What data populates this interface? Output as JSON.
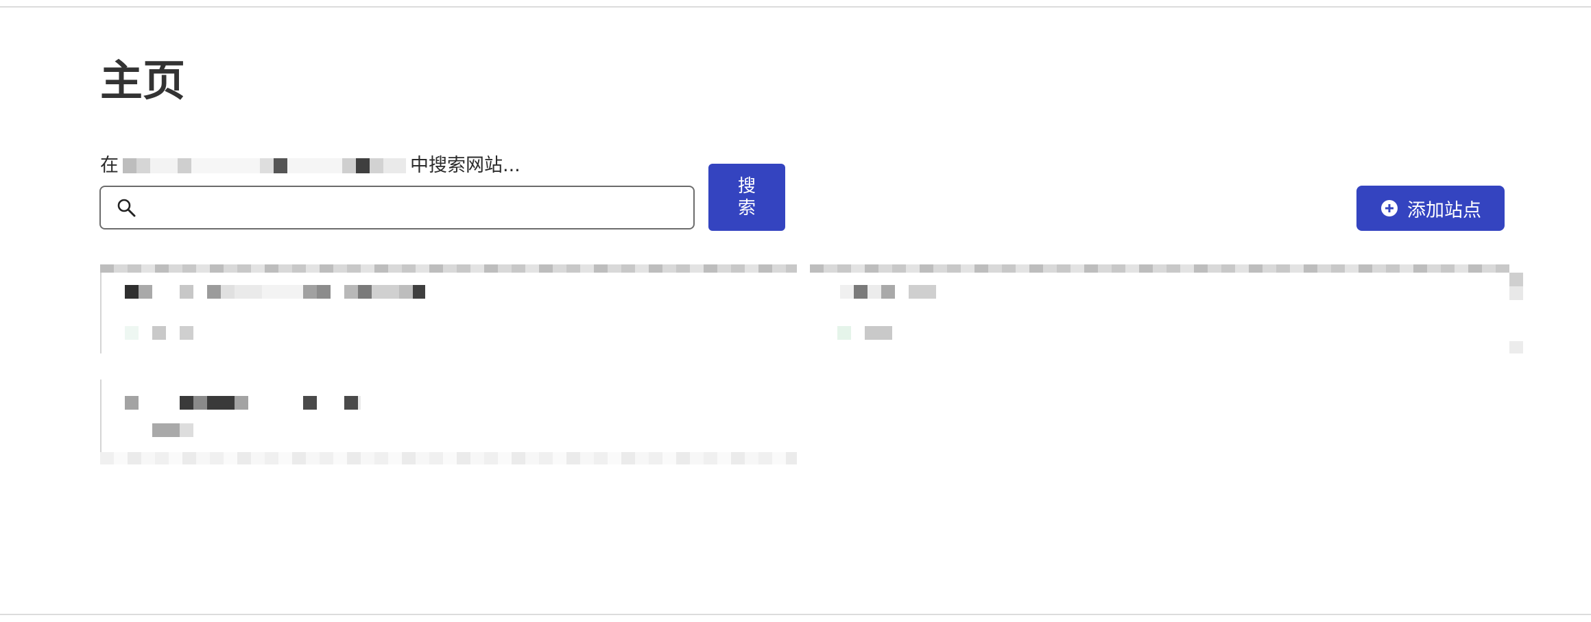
{
  "page": {
    "title": "主页"
  },
  "search": {
    "label_prefix": "在",
    "label_suffix": "中搜索网站...",
    "input_value": "",
    "button_label": "搜\n索"
  },
  "actions": {
    "add_site_label": "添加站点"
  },
  "site_cards": [
    {
      "title": "",
      "subtitle": ""
    },
    {
      "title": "",
      "subtitle": ""
    },
    {
      "title": "",
      "subtitle": ""
    }
  ],
  "colors": {
    "primary": "#3444c0",
    "text": "#2b2b2b",
    "border": "#6b6b6b"
  },
  "icons": {
    "search": "search-icon",
    "add": "plus-circle-icon"
  }
}
